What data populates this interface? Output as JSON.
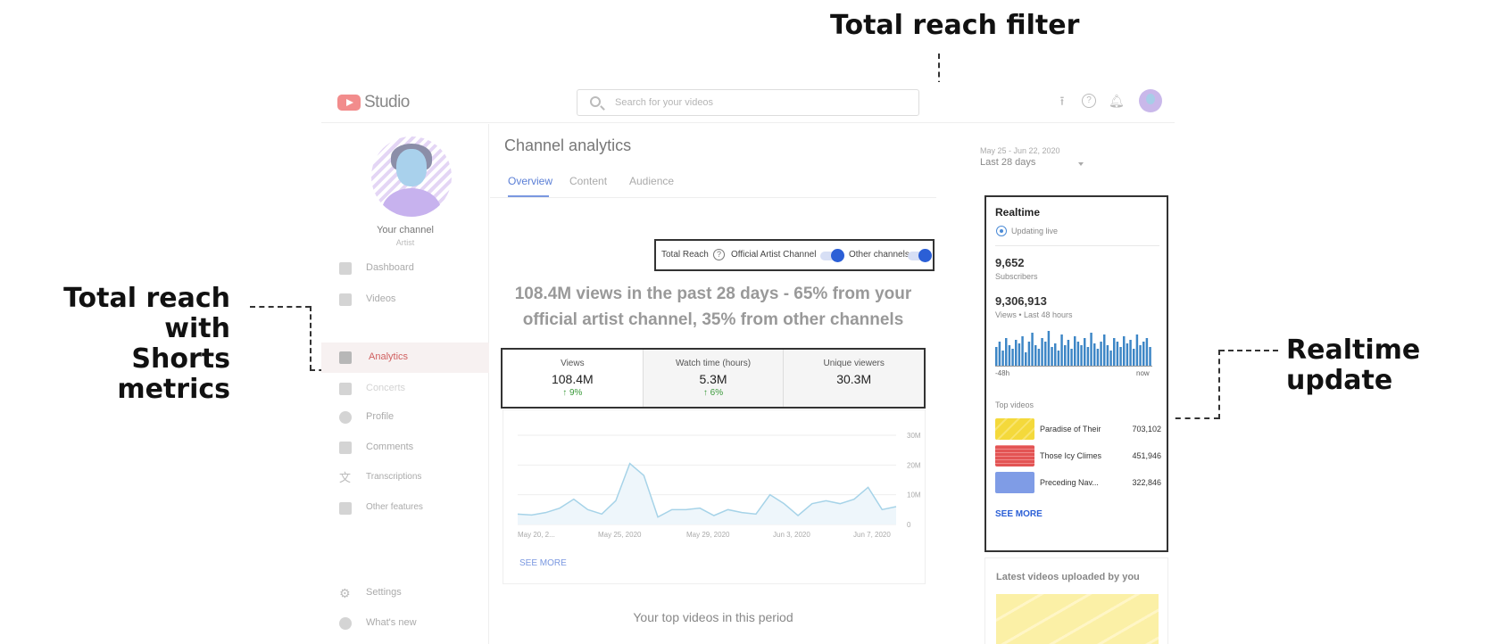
{
  "callouts": {
    "filter": "Total reach filter",
    "total_reach_line1": "Total reach with",
    "total_reach_line2": "Shorts metrics",
    "realtime": "Realtime update"
  },
  "header": {
    "logo_text": "Studio",
    "search_placeholder": "Search for your videos",
    "icons": [
      "upload-icon",
      "help-icon",
      "bell-icon",
      "account-avatar"
    ]
  },
  "channel": {
    "name": "Your channel",
    "role": "Artist"
  },
  "sidebar": {
    "items": [
      {
        "label": "Dashboard",
        "icon": "dashboard-icon"
      },
      {
        "label": "Videos",
        "icon": "videos-icon"
      },
      {
        "label": "Analytics",
        "icon": "analytics-icon",
        "active": true
      },
      {
        "label": "Concerts",
        "icon": "concerts-icon"
      },
      {
        "label": "Profile",
        "icon": "profile-icon"
      },
      {
        "label": "Comments",
        "icon": "comments-icon"
      },
      {
        "label": "Transcriptions",
        "icon": "translate-icon"
      },
      {
        "label": "Other features",
        "icon": "features-icon"
      }
    ],
    "bottom": [
      {
        "label": "Settings",
        "icon": "gear-icon"
      },
      {
        "label": "What's new",
        "icon": "info-icon"
      }
    ]
  },
  "main": {
    "title": "Channel analytics",
    "tabs": [
      {
        "label": "Overview",
        "active": true
      },
      {
        "label": "Content"
      },
      {
        "label": "Audience"
      }
    ],
    "date_range": "May 25 - Jun 22, 2020",
    "date_label": "Last 28 days",
    "filter": {
      "label": "Total Reach",
      "official_label": "Official Artist Channel",
      "other_label": "Other channels"
    },
    "headline": "108.4M views in the past 28 days - 65% from your official artist channel, 35% from other channels",
    "metrics": [
      {
        "label": "Views",
        "value": "108.4M",
        "delta": "9%"
      },
      {
        "label": "Watch time (hours)",
        "value": "5.3M",
        "delta": "6%"
      },
      {
        "label": "Unique viewers",
        "value": "30.3M",
        "delta": ""
      }
    ],
    "see_more": "SEE MORE",
    "top_videos_title": "Your top videos in this period"
  },
  "chart_data": {
    "type": "area",
    "x_tick_labels": [
      "May 20, 2...",
      "May 25, 2020",
      "May 29, 2020",
      "Jun 3, 2020",
      "Jun 7, 2020"
    ],
    "y_tick_labels": [
      "30M",
      "20M",
      "10M",
      "0"
    ],
    "ylim": [
      0,
      30
    ],
    "values": [
      3.5,
      3.2,
      4,
      5.5,
      8.5,
      5,
      3.5,
      8,
      20.5,
      16.5,
      2.5,
      5,
      5,
      5.5,
      3,
      5,
      4,
      3.5,
      10,
      7,
      3,
      7,
      8,
      7,
      8.5,
      12.5,
      5,
      6
    ],
    "color": "#a6d3e8",
    "grid": true
  },
  "realtime": {
    "title": "Realtime",
    "status": "Updating live",
    "subscribers": "9,652",
    "subscribers_label": "Subscribers",
    "views": "9,306,913",
    "views_label": "Views • Last 48 hours",
    "bars": [
      0.55,
      0.7,
      0.45,
      0.8,
      0.6,
      0.5,
      0.75,
      0.65,
      0.85,
      0.4,
      0.7,
      0.95,
      0.6,
      0.5,
      0.8,
      0.7,
      1.0,
      0.55,
      0.65,
      0.45,
      0.9,
      0.6,
      0.75,
      0.5,
      0.85,
      0.7,
      0.6,
      0.8,
      0.55,
      0.95,
      0.65,
      0.5,
      0.7,
      0.9,
      0.6,
      0.45,
      0.8,
      0.7,
      0.55,
      0.85,
      0.65,
      0.75,
      0.5,
      0.9,
      0.6,
      0.7,
      0.8,
      0.55
    ],
    "axis_start": "-48h",
    "axis_end": "now",
    "top_videos_label": "Top videos",
    "top_videos": [
      {
        "title": "Paradise of Their",
        "views": "703,102",
        "color": "#f4d93b"
      },
      {
        "title": "Those Icy Climes",
        "views": "451,946",
        "color": "#e35454"
      },
      {
        "title": "Preceding Nav...",
        "views": "322,846",
        "color": "#7f9ce6"
      }
    ],
    "see_more": "SEE MORE",
    "bar_color": "#3d86c6"
  },
  "latest": {
    "title": "Latest videos uploaded by you"
  }
}
